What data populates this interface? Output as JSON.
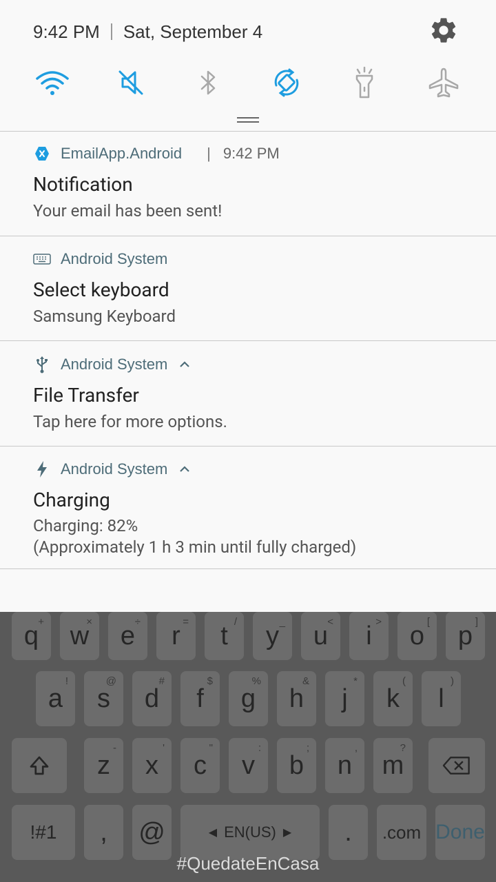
{
  "status_bar": {
    "time": "9:42 PM",
    "date": "Sat, September 4"
  },
  "quick_settings": [
    {
      "name": "wifi",
      "active": true
    },
    {
      "name": "sound-mute",
      "active": true
    },
    {
      "name": "bluetooth",
      "active": false
    },
    {
      "name": "auto-rotate",
      "active": true
    },
    {
      "name": "flashlight",
      "active": false
    },
    {
      "name": "airplane-mode",
      "active": false
    }
  ],
  "notifications": [
    {
      "app": "EmailApp.Android",
      "time": "9:42 PM",
      "title": "Notification",
      "text": "Your email has been sent!"
    },
    {
      "app": "Android System",
      "title": "Select keyboard",
      "text": "Samsung Keyboard"
    },
    {
      "app": "Android System",
      "title": "File Transfer",
      "text": "Tap here for more options."
    },
    {
      "app": "Android System",
      "title": "Charging",
      "text_line1": "Charging: 82%",
      "text_line2": "(Approximately 1 h 3 min until fully charged)"
    }
  ],
  "keyboard": {
    "row1": [
      {
        "main": "q",
        "sec": "+"
      },
      {
        "main": "w",
        "sec": "×"
      },
      {
        "main": "e",
        "sec": "÷"
      },
      {
        "main": "r",
        "sec": "="
      },
      {
        "main": "t",
        "sec": "/"
      },
      {
        "main": "y",
        "sec": "_"
      },
      {
        "main": "u",
        "sec": "<"
      },
      {
        "main": "i",
        "sec": ">"
      },
      {
        "main": "o",
        "sec": "["
      },
      {
        "main": "p",
        "sec": "]"
      }
    ],
    "row2": [
      {
        "main": "a",
        "sec": "!"
      },
      {
        "main": "s",
        "sec": "@"
      },
      {
        "main": "d",
        "sec": "#"
      },
      {
        "main": "f",
        "sec": "$"
      },
      {
        "main": "g",
        "sec": "%"
      },
      {
        "main": "h",
        "sec": "&"
      },
      {
        "main": "j",
        "sec": "*"
      },
      {
        "main": "k",
        "sec": "("
      },
      {
        "main": "l",
        "sec": ")"
      }
    ],
    "row3": [
      {
        "main": "z",
        "sec": "-"
      },
      {
        "main": "x",
        "sec": "'"
      },
      {
        "main": "c",
        "sec": "\""
      },
      {
        "main": "v",
        "sec": ":"
      },
      {
        "main": "b",
        "sec": ";"
      },
      {
        "main": "n",
        "sec": ","
      },
      {
        "main": "m",
        "sec": "?"
      }
    ],
    "symbols_label": "!#1",
    "comma_label": ",",
    "at_label": "@",
    "space_label": "EN(US)",
    "period_label": ".",
    "com_label": ".com",
    "done_label": "Done"
  },
  "overlay_text": "#QuedateEnCasa",
  "colors": {
    "accent": "#1e9de0",
    "inactive_icon": "#a8a8a8",
    "app_name": "#4d6c78"
  }
}
